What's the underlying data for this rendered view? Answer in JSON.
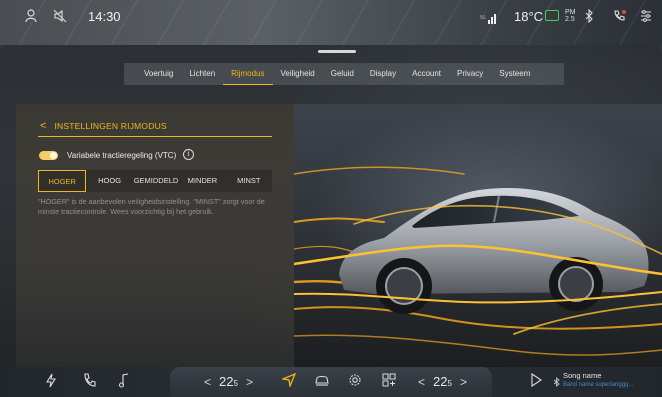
{
  "status": {
    "time": "14:30",
    "temperature": "18°C",
    "pm_line1": "PM",
    "pm_line2": "2.5"
  },
  "tabs": [
    {
      "label": "Voertuig",
      "active": false
    },
    {
      "label": "Lichten",
      "active": false
    },
    {
      "label": "Rijmodus",
      "active": true
    },
    {
      "label": "Veiligheid",
      "active": false
    },
    {
      "label": "Geluid",
      "active": false
    },
    {
      "label": "Display",
      "active": false
    },
    {
      "label": "Account",
      "active": false
    },
    {
      "label": "Privacy",
      "active": false
    },
    {
      "label": "Systeem",
      "active": false
    }
  ],
  "settings": {
    "back_glyph": "<",
    "title": "INSTELLINGEN RIJMODUS",
    "vtc_label": "Variabele tractieregeling (VTC)",
    "vtc_enabled": true,
    "info_glyph": "i",
    "segments": [
      "HOGER",
      "HOOG",
      "GEMIDDELD",
      "MINDER",
      "MINST"
    ],
    "selected_segment": "HOGER",
    "hint": "\"HOGER\" is de aanbevolen veiligheidsinstelling. \"MINST\" zorgt voor de minste tractiecontrole. Wees voorzichtig bij het gebruik."
  },
  "dock": {
    "left_temp": "22",
    "left_temp_dec": "5",
    "right_temp": "22",
    "right_temp_dec": "5",
    "arrow_left": "<",
    "arrow_right": ">",
    "song_name": "Song name",
    "song_artist": "Band name superlanggg..."
  },
  "colors": {
    "accent": "#f0b71b",
    "battery": "#3fd05a",
    "song_artist": "#4b86c9"
  }
}
